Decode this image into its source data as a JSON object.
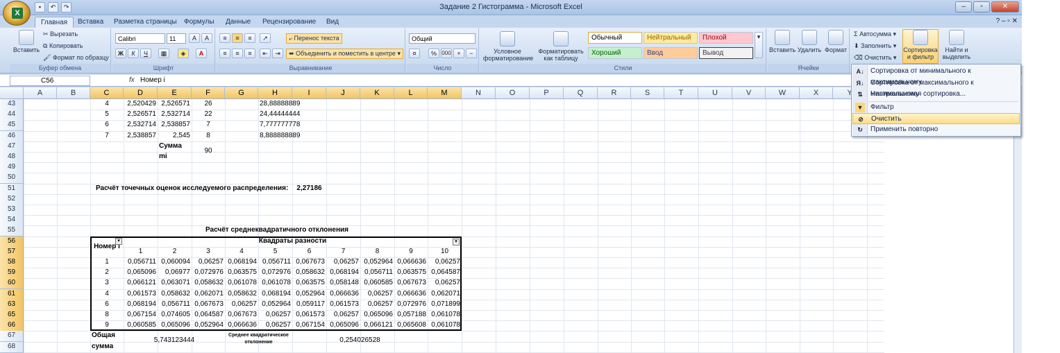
{
  "window": {
    "title": "Задание 2 Гистограмма - Microsoft Excel"
  },
  "tabs": [
    "Главная",
    "Вставка",
    "Разметка страницы",
    "Формулы",
    "Данные",
    "Рецензирование",
    "Вид"
  ],
  "ribbon": {
    "clipboard": {
      "paste": "Вставить",
      "cut": "Вырезать",
      "copy": "Копировать",
      "format_painter": "Формат по образцу",
      "label": "Буфер обмена"
    },
    "font": {
      "name": "Calibri",
      "size": "11",
      "label": "Шрифт",
      "bold": "Ж",
      "italic": "К",
      "underline": "Ч"
    },
    "alignment": {
      "wrap": "Перенос текста",
      "merge": "Объединить и поместить в центре",
      "label": "Выравнивание"
    },
    "number": {
      "format": "Общий",
      "percent": "%",
      "thousands": "000",
      "label": "Число"
    },
    "styles": {
      "conditional": "Условное форматирование",
      "as_table": "Форматировать как таблицу",
      "normal": "Обычный",
      "neutral": "Нейтральный",
      "bad": "Плохой",
      "good": "Хороший",
      "input": "Ввод",
      "output": "Вывод",
      "label": "Стили"
    },
    "cells": {
      "insert": "Вставить",
      "delete": "Удалить",
      "format": "Формат",
      "label": "Ячейки"
    },
    "editing": {
      "autosum": "Автосумма",
      "fill": "Заполнить",
      "clear": "Очистить",
      "sort_filter": "Сортировка и фильтр",
      "find_select": "Найти и выделить"
    }
  },
  "formula_bar": {
    "name_box": "C56",
    "fx": "fx",
    "value": "Номер i"
  },
  "columns": [
    "A",
    "B",
    "C",
    "D",
    "E",
    "F",
    "G",
    "H",
    "I",
    "J",
    "K",
    "L",
    "M",
    "N",
    "O",
    "P",
    "Q",
    "R",
    "S",
    "T",
    "U",
    "V",
    "W",
    "X",
    "Y"
  ],
  "rows": [
    "43",
    "44",
    "45",
    "46",
    "47",
    "48",
    "49",
    "50",
    "51",
    "52",
    "53",
    "54",
    "55",
    "56",
    "57",
    "58",
    "59",
    "60",
    "61",
    "63",
    "65",
    "66",
    "67",
    "68"
  ],
  "top_data": [
    {
      "c": "4",
      "d": "2,520429",
      "e": "2,526571",
      "f": "26",
      "h": "28,88888889"
    },
    {
      "c": "5",
      "d": "2,526571",
      "e": "2,532714",
      "f": "22",
      "h": "24,44444444"
    },
    {
      "c": "6",
      "d": "2,532714",
      "e": "2,538857",
      "f": "7",
      "h": "7,777777778"
    },
    {
      "c": "7",
      "d": "2,538857",
      "e": "2,545",
      "f": "8",
      "h": "8,888888889"
    }
  ],
  "summa": {
    "label1": "Сумма",
    "label2": "mi",
    "value": "90"
  },
  "estimate": {
    "label": "Расчёт точечных оценок исследуемого распределения:",
    "value": "2,27186"
  },
  "std_table": {
    "title": "Расчёт среднеквадратичного отклонения",
    "number_header": "Номер i",
    "squares_header": "Квадраты разности",
    "col_numbers": [
      "1",
      "2",
      "3",
      "4",
      "5",
      "6",
      "7",
      "8",
      "9",
      "10"
    ],
    "rows": [
      {
        "i": "1",
        "v": [
          "0,056711",
          "0,060094",
          "0,06257",
          "0,068194",
          "0,056711",
          "0,067673",
          "0,06257",
          "0,052964",
          "0,066636",
          "0,06257"
        ]
      },
      {
        "i": "2",
        "v": [
          "0,065096",
          "0,06977",
          "0,072976",
          "0,063575",
          "0,072976",
          "0,058632",
          "0,068194",
          "0,056711",
          "0,063575",
          "0,064587"
        ]
      },
      {
        "i": "3",
        "v": [
          "0,066121",
          "0,063071",
          "0,058632",
          "0,061078",
          "0,061078",
          "0,063575",
          "0,058148",
          "0,060585",
          "0,067673",
          "0,06257"
        ]
      },
      {
        "i": "4",
        "v": [
          "0,061573",
          "0,058632",
          "0,062071",
          "0,058632",
          "0,068194",
          "0,052964",
          "0,066636",
          "0,06257",
          "0,066636",
          "0,062071"
        ]
      },
      {
        "i": "6",
        "v": [
          "0,068194",
          "0,056711",
          "0,067673",
          "0,06257",
          "0,052964",
          "0,059117",
          "0,061573",
          "0,06257",
          "0,072976",
          "0,071899"
        ]
      },
      {
        "i": "8",
        "v": [
          "0,067154",
          "0,074605",
          "0,064587",
          "0,067673",
          "0,06257",
          "0,061573",
          "0,06257",
          "0,065096",
          "0,057188",
          "0,061078"
        ]
      },
      {
        "i": "9",
        "v": [
          "0,060585",
          "0,065096",
          "0,052964",
          "0,066636",
          "0,06257",
          "0,067154",
          "0,065096",
          "0,066121",
          "0,065608",
          "0,061078"
        ]
      }
    ],
    "total_label1": "Общая",
    "total_label2": "сумма",
    "total_value": "5,743123444",
    "std_label1": "Среднее квадратическое",
    "std_label2": "отклонение",
    "std_value": "0,254026528"
  },
  "sort_menu": {
    "items": [
      "Сортировка от минимального к максимальному",
      "Сортировка от максимального к минимальному",
      "Настраиваемая сортировка...",
      "Фильтр",
      "Очистить",
      "Применить повторно"
    ]
  }
}
